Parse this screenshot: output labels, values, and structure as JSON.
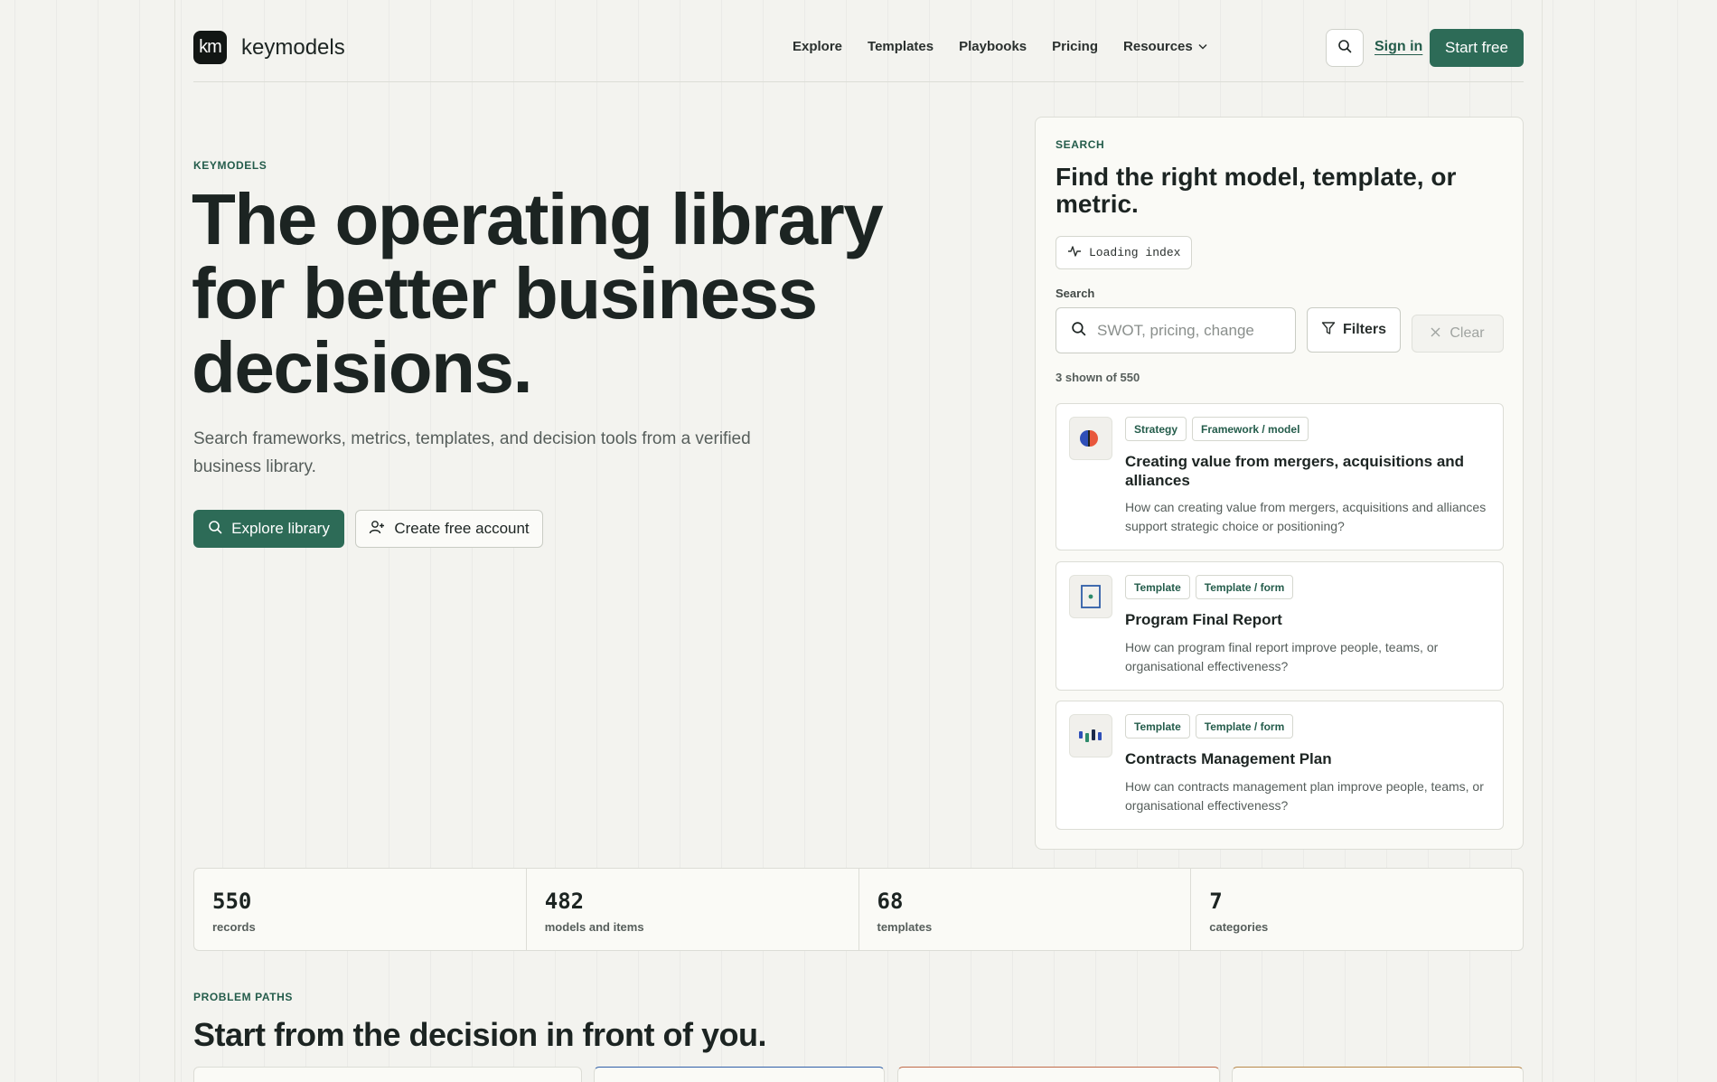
{
  "brand": {
    "logo_mark": "km",
    "name": "keymodels"
  },
  "nav": {
    "items": [
      "Explore",
      "Templates",
      "Playbooks",
      "Pricing",
      "Resources"
    ],
    "resources_icon": "chevron-down-icon",
    "search_icon": "search-icon",
    "signin_label": "Sign in",
    "start_free_label": "Start free"
  },
  "hero": {
    "eyebrow": "KEYMODELS",
    "title": "The operating library for better business decisions.",
    "subtitle": "Search frameworks, metrics, templates, and decision tools from a verified business library.",
    "explore_label": "Explore library",
    "create_account_label": "Create free account"
  },
  "search_panel": {
    "eyebrow": "SEARCH",
    "title": "Find the right model, template, or metric.",
    "status": "Loading index",
    "search_label": "Search",
    "search_placeholder": "SWOT, pricing, change",
    "search_value": "",
    "filters_label": "Filters",
    "clear_label": "Clear",
    "results_count": "3 shown of 550",
    "results": [
      {
        "badges": [
          "Strategy",
          "Framework / model"
        ],
        "title": "Creating value from mergers, acquisitions and alliances",
        "description": "How can creating value from mergers, acquisitions and alliances support strategic choice or positioning?",
        "icon": "split-circle-icon"
      },
      {
        "badges": [
          "Template",
          "Template / form"
        ],
        "title": "Program Final Report",
        "description": "How can program final report improve people, teams, or organisational effectiveness?",
        "icon": "document-frame-icon"
      },
      {
        "badges": [
          "Template",
          "Template / form"
        ],
        "title": "Contracts Management Plan",
        "description": "How can contracts management plan improve people, teams, or organisational effectiveness?",
        "icon": "bar-columns-icon"
      }
    ]
  },
  "stats": [
    {
      "value": "550",
      "label": "records"
    },
    {
      "value": "482",
      "label": "models and items"
    },
    {
      "value": "68",
      "label": "templates"
    },
    {
      "value": "7",
      "label": "categories"
    }
  ],
  "problem_paths": {
    "eyebrow": "PROBLEM PATHS",
    "title": "Start from the decision in front of you."
  },
  "colors": {
    "accent": "#2d6b57",
    "accent_text": "#245c4b",
    "background": "#f3f3ef",
    "ink": "#1c2422"
  }
}
